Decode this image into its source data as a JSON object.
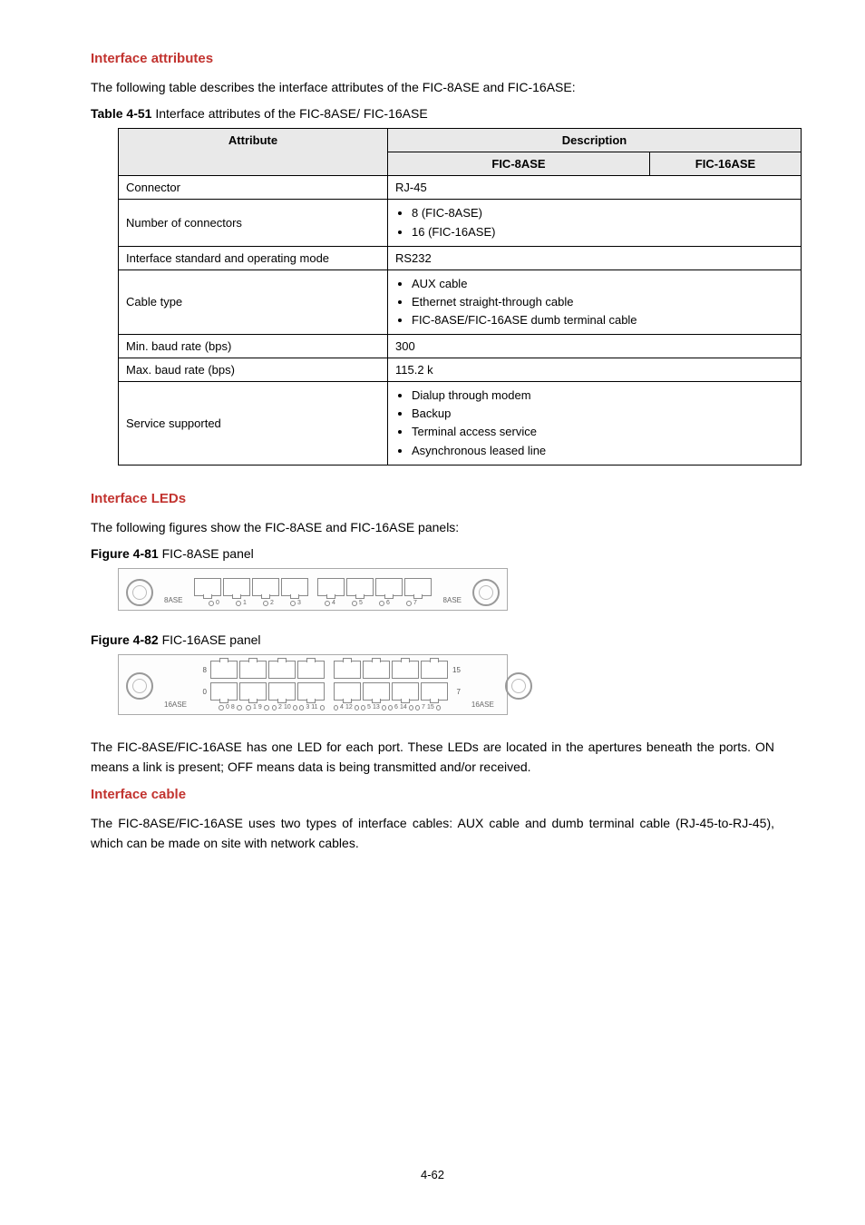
{
  "sections": {
    "attributes": {
      "title": "Interface attributes",
      "intro": "The following table describes the interface attributes of the FIC-8ASE and FIC-16ASE:",
      "tableCaptionPrefix": "Table 4-51",
      "tableCaptionRest": " Interface attributes of the FIC-8ASE/ FIC-16ASE",
      "headers": {
        "attribute": "Attribute",
        "description": "Description",
        "col1": "FIC-8ASE",
        "col2": "FIC-16ASE"
      },
      "rows": [
        {
          "attr": "Connector",
          "single": "RJ-45"
        },
        {
          "attr": "Number of connectors",
          "bullets": [
            "8 (FIC-8ASE)",
            "16 (FIC-16ASE)"
          ]
        },
        {
          "attr": "Interface standard and operating mode",
          "single": "RS232"
        },
        {
          "attr": "Cable type",
          "bullets": [
            "AUX cable",
            "Ethernet straight-through cable",
            "FIC-8ASE/FIC-16ASE dumb terminal cable"
          ]
        },
        {
          "attr": "Min. baud rate (bps)",
          "single": "300"
        },
        {
          "attr": "Max. baud rate (bps)",
          "single": "115.2 k"
        },
        {
          "attr": "Service supported",
          "bullets": [
            "Dialup through modem",
            "Backup",
            "Terminal access service",
            "Asynchronous leased line"
          ]
        }
      ]
    },
    "leds": {
      "title": "Interface LEDs",
      "intro": "The following figures show the FIC-8ASE and FIC-16ASE panels:",
      "fig81Prefix": "Figure 4-81",
      "fig81Rest": " FIC-8ASE panel",
      "fig82Prefix": "Figure 4-82",
      "fig82Rest": " FIC-16ASE panel",
      "panel8": {
        "leftLabel": "8ASE",
        "rightLabel": "8ASE",
        "portLabels": [
          "0",
          "1",
          "2",
          "3",
          "4",
          "5",
          "6",
          "7"
        ]
      },
      "panel16": {
        "leftLabel": "16ASE",
        "rightLabel": "16ASE",
        "topRowLeft": "8",
        "topRowRight": "15",
        "botRowLeft": "0",
        "botRowRight": "7",
        "ledPairs": [
          "0 8",
          "1 9",
          "2 10",
          "3 11",
          "4 12",
          "5 13",
          "6 14",
          "7 15"
        ]
      },
      "note": "The FIC-8ASE/FIC-16ASE has one LED for each port. These LEDs are located in the apertures beneath the ports. ON means a link is present; OFF means data is being transmitted and/or received."
    },
    "cable": {
      "title": "Interface cable",
      "body": "The FIC-8ASE/FIC-16ASE uses two types of interface cables: AUX cable and dumb terminal cable (RJ-45-to-RJ-45), which can be made on site with network cables."
    }
  },
  "footer": "4-62"
}
